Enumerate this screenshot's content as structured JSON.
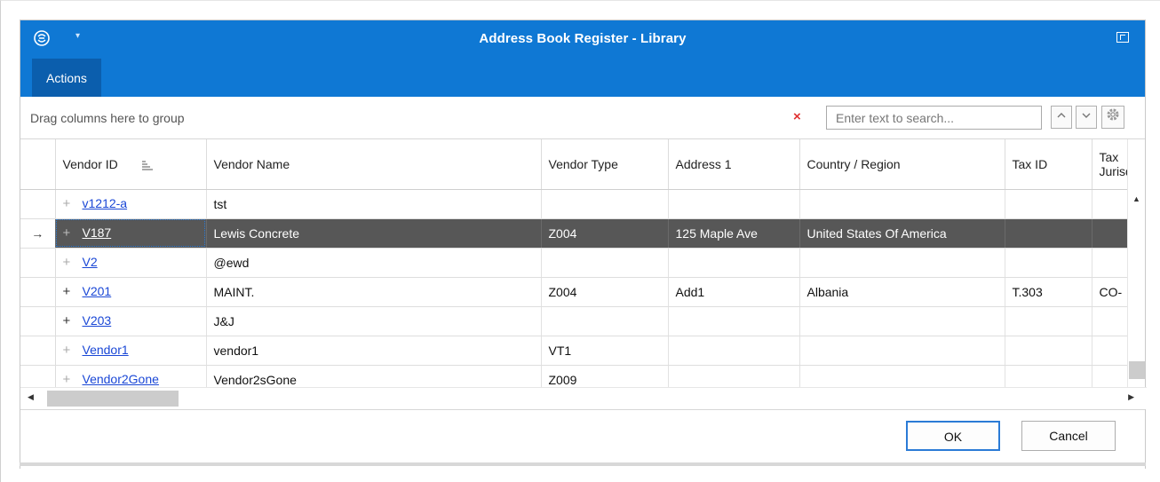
{
  "window": {
    "title": "Address Book Register - Library",
    "accent_color": "#0f78d4",
    "app_icon": "app-logo-icon",
    "menu_caret": "▾"
  },
  "ribbon": {
    "tabs": [
      {
        "label": "Actions",
        "active": true
      }
    ]
  },
  "toolbar": {
    "group_hint": "Drag columns here to group",
    "clear_icon": "×",
    "search_placeholder": "Enter text to search...",
    "search_value": "",
    "find_prev_icon": "^",
    "find_next_icon": "v",
    "settings_icon": "gear-icon"
  },
  "grid": {
    "columns": [
      {
        "key": "indicator",
        "label": ""
      },
      {
        "key": "vendor_id",
        "label": "Vendor ID",
        "sorted": true
      },
      {
        "key": "vendor_name",
        "label": "Vendor Name"
      },
      {
        "key": "vendor_type",
        "label": "Vendor Type"
      },
      {
        "key": "address1",
        "label": "Address 1"
      },
      {
        "key": "country",
        "label": "Country / Region"
      },
      {
        "key": "tax_id",
        "label": "Tax ID"
      },
      {
        "key": "tax_jurisdiction",
        "label": "Tax Jurisd..."
      }
    ],
    "rows": [
      {
        "indicator": "",
        "expand": "+",
        "vendor_id": "v1212-a",
        "vendor_name": "tst",
        "vendor_type": "",
        "address1": "",
        "country": "",
        "tax_id": "",
        "tax_jurisdiction": ""
      },
      {
        "indicator": "→",
        "expand": "+",
        "vendor_id": "V187",
        "vendor_name": "Lewis Concrete",
        "vendor_type": "Z004",
        "address1": "125 Maple Ave",
        "country": "United States Of America",
        "tax_id": "",
        "tax_jurisdiction": "",
        "selected": true
      },
      {
        "indicator": "",
        "expand": "+",
        "vendor_id": "V2",
        "vendor_name": "@ewd",
        "vendor_type": "",
        "address1": "",
        "country": "",
        "tax_id": "",
        "tax_jurisdiction": ""
      },
      {
        "indicator": "",
        "expand": "+",
        "vendor_id": "V201",
        "vendor_name": "MAINT.",
        "vendor_type": "Z004",
        "address1": "Add1",
        "country": "Albania",
        "tax_id": "T.303",
        "tax_jurisdiction": "CO-"
      },
      {
        "indicator": "",
        "expand": "+",
        "vendor_id": "V203",
        "vendor_name": "J&J",
        "vendor_type": "",
        "address1": "",
        "country": "",
        "tax_id": "",
        "tax_jurisdiction": ""
      },
      {
        "indicator": "",
        "expand": "+",
        "vendor_id": "Vendor1",
        "vendor_name": "vendor1",
        "vendor_type": "VT1",
        "address1": "",
        "country": "",
        "tax_id": "",
        "tax_jurisdiction": ""
      },
      {
        "indicator": "",
        "expand": "+",
        "vendor_id": "Vendor2Gone",
        "vendor_name": "Vendor2sGone",
        "vendor_type": "Z009",
        "address1": "",
        "country": "",
        "tax_id": "",
        "tax_jurisdiction": ""
      }
    ]
  },
  "footer": {
    "ok_label": "OK",
    "cancel_label": "Cancel"
  }
}
